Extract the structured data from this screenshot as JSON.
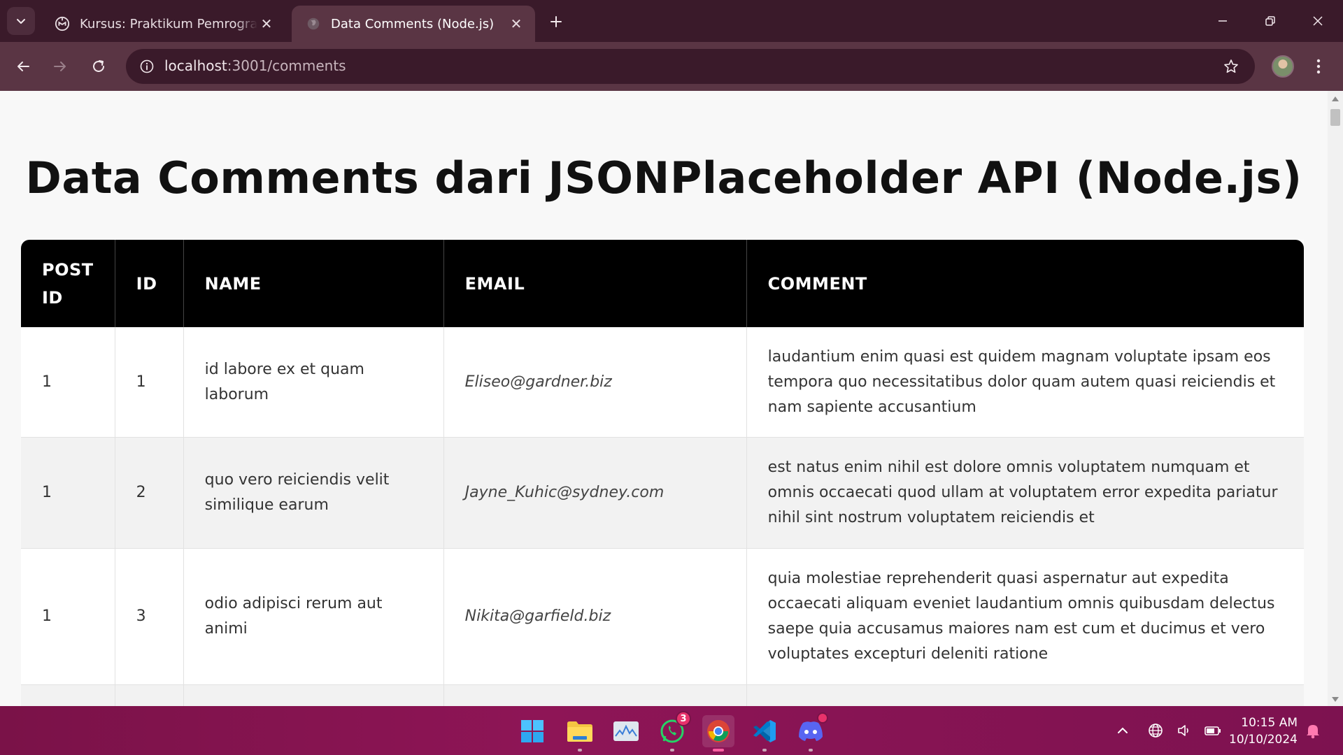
{
  "browser": {
    "tabs": [
      {
        "title": "Kursus: Praktikum Pemrograman",
        "icon": "moodle-icon",
        "active": false
      },
      {
        "title": "Data Comments (Node.js)",
        "icon": "globe-icon",
        "active": true
      }
    ],
    "address": {
      "host": "localhost",
      "path": ":3001/comments"
    }
  },
  "page": {
    "title": "Data Comments dari JSONPlaceholder API (Node.js)",
    "table": {
      "headers": {
        "post_id": "POST ID",
        "id": "ID",
        "name": "NAME",
        "email": "EMAIL",
        "comment": "COMMENT"
      },
      "rows": [
        {
          "post_id": "1",
          "id": "1",
          "name": "id labore ex et quam laborum",
          "email": "Eliseo@gardner.biz",
          "comment": "laudantium enim quasi est quidem magnam voluptate ipsam eos tempora quo necessitatibus dolor quam autem quasi reiciendis et nam sapiente accusantium"
        },
        {
          "post_id": "1",
          "id": "2",
          "name": "quo vero reiciendis velit similique earum",
          "email": "Jayne_Kuhic@sydney.com",
          "comment": "est natus enim nihil est dolore omnis voluptatem numquam et omnis occaecati quod ullam at voluptatem error expedita pariatur nihil sint nostrum voluptatem reiciendis et"
        },
        {
          "post_id": "1",
          "id": "3",
          "name": "odio adipisci rerum aut animi",
          "email": "Nikita@garfield.biz",
          "comment": "quia molestiae reprehenderit quasi aspernatur aut expedita occaecati aliquam eveniet laudantium omnis quibusdam delectus saepe quia accusamus maiores nam est cum et ducimus et vero voluptates excepturi deleniti ratione"
        }
      ]
    }
  },
  "taskbar": {
    "apps": [
      {
        "name": "windows-start-icon"
      },
      {
        "name": "file-explorer-icon"
      },
      {
        "name": "task-manager-icon"
      },
      {
        "name": "whatsapp-icon",
        "badge": "3"
      },
      {
        "name": "chrome-icon",
        "active": true
      },
      {
        "name": "vscode-icon"
      },
      {
        "name": "discord-icon"
      }
    ],
    "clock": {
      "time": "10:15 AM",
      "date": "10/10/2024"
    }
  },
  "colors": {
    "tabstrip": "#3a1a2a",
    "toolbar": "#5a3544",
    "table_header": "#000000",
    "taskbar": "#8e1556"
  }
}
